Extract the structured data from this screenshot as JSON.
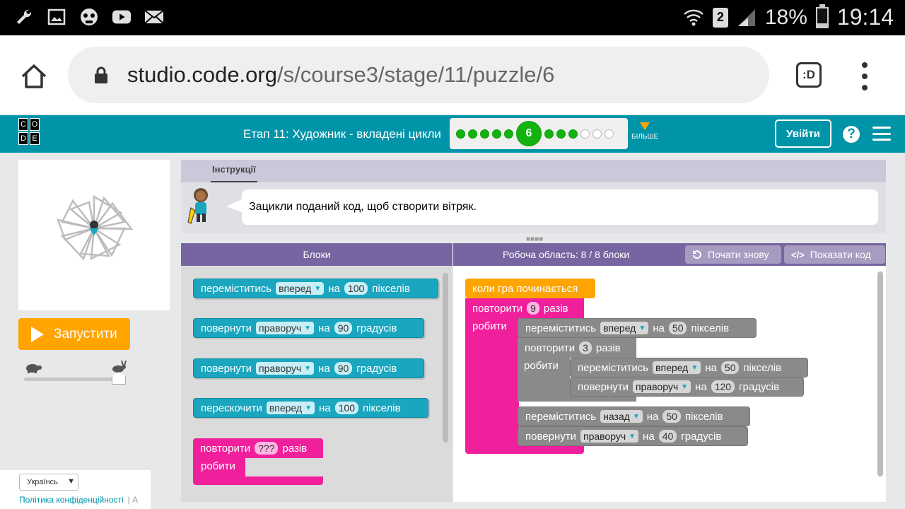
{
  "status_bar": {
    "icons_left": [
      "wrench-icon",
      "image-icon",
      "skull-icon",
      "youtube-icon",
      "mail-icon"
    ],
    "sim_label": "2",
    "battery": "18%",
    "battery_level": 0.18,
    "time": "19:14"
  },
  "browser": {
    "url_host": "studio.code.org",
    "url_path": "/s/course3/stage/11/puzzle/6",
    "tabs_label": ":D"
  },
  "header": {
    "logo_letters": [
      "C",
      "O",
      "D",
      "E"
    ],
    "stage_title": "Етап 11: Художник - вкладені цикли",
    "current_puzzle": "6",
    "progress": {
      "done_before": 5,
      "done_after": 3,
      "empty_after": 3
    },
    "more_label": "БІЛЬШЕ",
    "signin_label": "Увійти",
    "help_label": "?",
    "accent_color": "#0094a8"
  },
  "left": {
    "run_label": "Запустити",
    "language": "Українсь",
    "privacy_link": "Політика конфіденційності",
    "privacy_sep": "|  A",
    "speed_level": 1.0
  },
  "instructions": {
    "tab_label": "Інструкції",
    "text": "Зацикли поданий код, щоб створити вітряк."
  },
  "workspace_header": {
    "blocks_title": "Блоки",
    "workspace_title": "Робоча область: 8 / 8 блоки",
    "restart_label": "Почати знову",
    "show_code_label": "Показати код"
  },
  "toolbox": {
    "move": {
      "verb": "переміститись",
      "dir": "вперед",
      "on": "на",
      "value": "100",
      "unit": "пікселів"
    },
    "turn1": {
      "verb": "повернути",
      "dir": "праворуч",
      "on": "на",
      "value": "90",
      "unit": "градусів"
    },
    "turn2": {
      "verb": "повернути",
      "dir": "праворуч",
      "on": "на",
      "value": "90",
      "unit": "градусів"
    },
    "jump": {
      "verb": "перескочити",
      "dir": "вперед",
      "on": "на",
      "value": "100",
      "unit": "пікселів"
    },
    "repeat": {
      "verb": "повторити",
      "value": "???",
      "unit": "разів",
      "do": "робити"
    }
  },
  "program": {
    "when_run": "коли гра починається",
    "outer_repeat": {
      "verb": "повторити",
      "value": "9",
      "unit": "разів",
      "do": "робити"
    },
    "move1": {
      "verb": "переміститись",
      "dir": "вперед",
      "on": "на",
      "value": "50",
      "unit": "пікселів"
    },
    "inner_repeat": {
      "verb": "повторити",
      "value": "3",
      "unit": "разів",
      "do": "робити"
    },
    "inner_move": {
      "verb": "переміститись",
      "dir": "вперед",
      "on": "на",
      "value": "50",
      "unit": "пікселів"
    },
    "inner_turn": {
      "verb": "повернути",
      "dir": "праворуч",
      "on": "на",
      "value": "120",
      "unit": "градусів"
    },
    "move_back": {
      "verb": "переміститись",
      "dir": "назад",
      "on": "на",
      "value": "50",
      "unit": "пікселів"
    },
    "turn_last": {
      "verb": "повернути",
      "dir": "праворуч",
      "on": "на",
      "value": "40",
      "unit": "градусів"
    }
  }
}
